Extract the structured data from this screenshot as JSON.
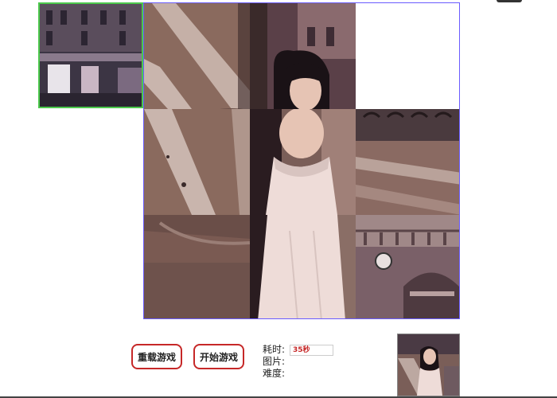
{
  "controls": {
    "reload_label": "重载游戏",
    "start_label": "开始游戏"
  },
  "info": {
    "time_label": "耗时:",
    "time_value": "35秒",
    "image_label": "图片:",
    "image_value": "",
    "difficulty_label": "难度:",
    "difficulty_value": ""
  },
  "puzzle": {
    "grid": "3x3",
    "empty_slot": "row-1-col-3",
    "held_piece": "building-storefront",
    "tiles": [
      "road-crosswalk-left",
      "woman-face-hair",
      "empty",
      "road-crosswalk-lower",
      "woman-shoulders-dress",
      "street-night-road",
      "sidewalk-curb",
      "woman-dress-lower",
      "building-arch-sign"
    ]
  },
  "colors": {
    "board_border": "#6a5cff",
    "held_border": "#4cc94c",
    "button_border": "#c62828",
    "time_value": "#c62828"
  }
}
